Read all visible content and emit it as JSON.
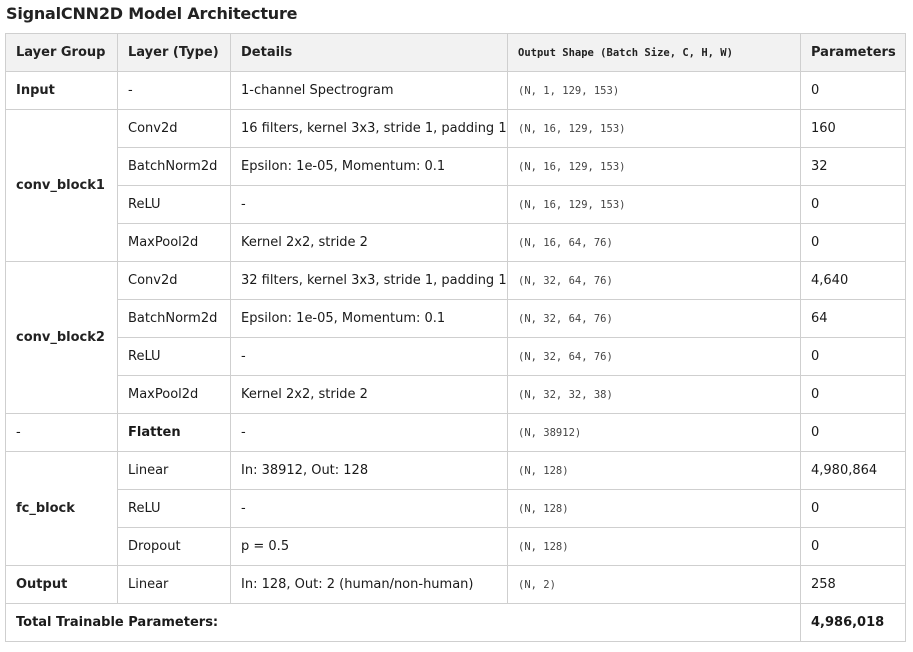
{
  "title": "SignalCNN2D Model Architecture",
  "headers": {
    "group": "Layer Group",
    "type": "Layer (Type)",
    "details": "Details",
    "shape": "Output Shape (Batch Size, C, H, W)",
    "params": "Parameters"
  },
  "groups": {
    "input": "Input",
    "conv1": "conv_block1",
    "conv2": "conv_block2",
    "flatten": "-",
    "fc": "fc_block",
    "output": "Output"
  },
  "rows": [
    {
      "type": "-",
      "details": "1-channel Spectrogram",
      "shape": "(N, 1, 129, 153)",
      "params": "0"
    },
    {
      "type": "Conv2d",
      "details": "16 filters, kernel 3x3, stride 1, padding 1",
      "shape": "(N, 16, 129, 153)",
      "params": "160"
    },
    {
      "type": "BatchNorm2d",
      "details": "Epsilon: 1e-05, Momentum: 0.1",
      "shape": "(N, 16, 129, 153)",
      "params": "32"
    },
    {
      "type": "ReLU",
      "details": "-",
      "shape": "(N, 16, 129, 153)",
      "params": "0"
    },
    {
      "type": "MaxPool2d",
      "details": "Kernel 2x2, stride 2",
      "shape": "(N, 16, 64, 76)",
      "params": "0"
    },
    {
      "type": "Conv2d",
      "details": "32 filters, kernel 3x3, stride 1, padding 1",
      "shape": "(N, 32, 64, 76)",
      "params": "4,640"
    },
    {
      "type": "BatchNorm2d",
      "details": "Epsilon: 1e-05, Momentum: 0.1",
      "shape": "(N, 32, 64, 76)",
      "params": "64"
    },
    {
      "type": "ReLU",
      "details": "-",
      "shape": "(N, 32, 64, 76)",
      "params": "0"
    },
    {
      "type": "MaxPool2d",
      "details": "Kernel 2x2, stride 2",
      "shape": "(N, 32, 32, 38)",
      "params": "0"
    },
    {
      "type": "Flatten",
      "details": "-",
      "shape": "(N, 38912)",
      "params": "0"
    },
    {
      "type": "Linear",
      "details": "In: 38912, Out: 128",
      "shape": "(N, 128)",
      "params": "4,980,864"
    },
    {
      "type": "ReLU",
      "details": "-",
      "shape": "(N, 128)",
      "params": "0"
    },
    {
      "type": "Dropout",
      "details": "p = 0.5",
      "shape": "(N, 128)",
      "params": "0"
    },
    {
      "type": "Linear",
      "details": "In: 128, Out: 2 (human/non-human)",
      "shape": "(N, 2)",
      "params": "258"
    }
  ],
  "total": {
    "label": "Total Trainable Parameters:",
    "value": "4,986,018"
  }
}
